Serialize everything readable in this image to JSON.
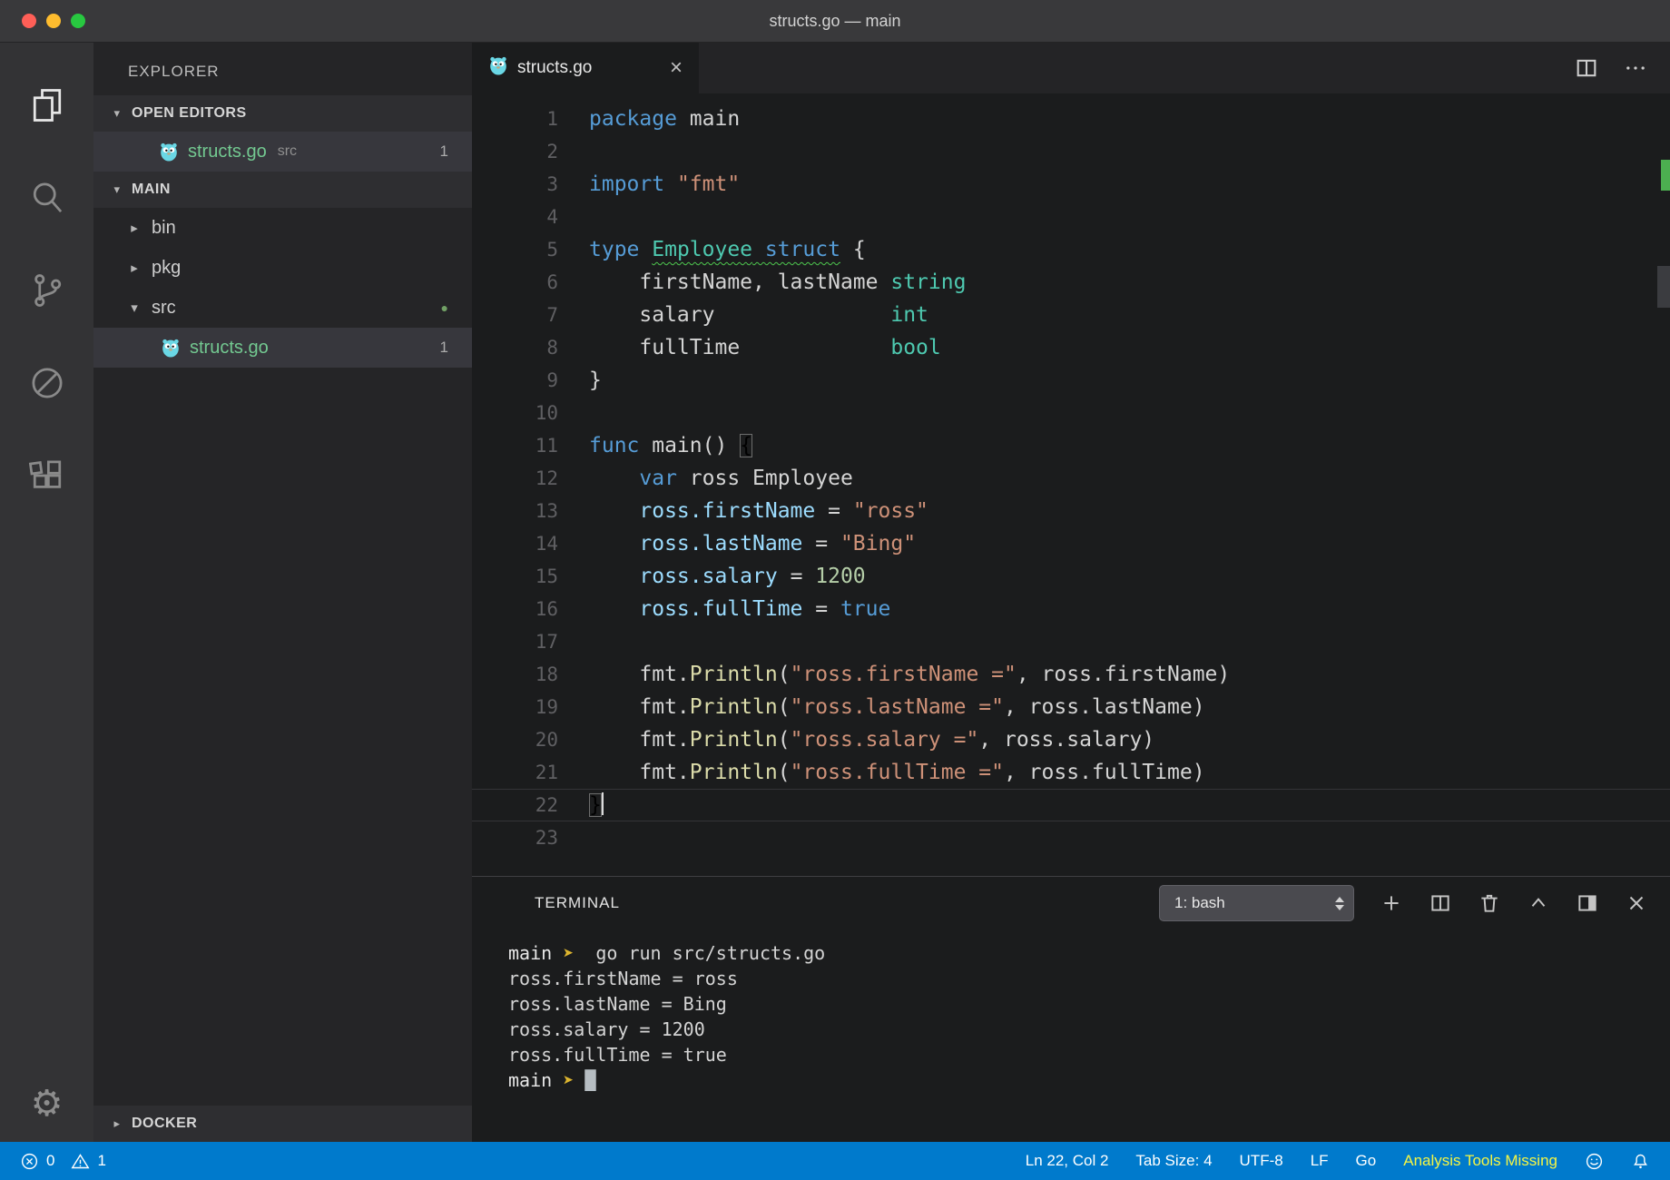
{
  "window": {
    "title": "structs.go — main"
  },
  "activity_bar": {
    "icons": [
      "files-icon",
      "search-icon",
      "source-control-icon",
      "debug-icon",
      "extensions-icon",
      "settings-gear-icon"
    ]
  },
  "sidebar": {
    "title": "EXPLORER",
    "open_editors": {
      "header": "OPEN EDITORS",
      "items": [
        {
          "file": "structs.go",
          "detail": "src",
          "badge": "1",
          "icon": "go-gopher-icon",
          "selected": true
        }
      ]
    },
    "folder_section": {
      "header": "MAIN",
      "tree": [
        {
          "type": "folder",
          "state": "collapsed",
          "label": "bin",
          "indent": 0
        },
        {
          "type": "folder",
          "state": "collapsed",
          "label": "pkg",
          "indent": 0
        },
        {
          "type": "folder",
          "state": "expanded",
          "label": "src",
          "indent": 0,
          "modified_dot": true
        },
        {
          "type": "file",
          "icon": "go-gopher-icon",
          "label": "structs.go",
          "indent": 1,
          "badge": "1",
          "selected": true,
          "green": true
        }
      ]
    },
    "bottom_section": {
      "header": "DOCKER",
      "state": "collapsed"
    }
  },
  "editor": {
    "tab": {
      "label": "structs.go",
      "close": "×"
    },
    "cursor_line": 22,
    "lines": [
      [
        [
          "k",
          "package"
        ],
        [
          "d",
          " main"
        ]
      ],
      [],
      [
        [
          "k",
          "import"
        ],
        [
          "d",
          " "
        ],
        [
          "s",
          "\"fmt\""
        ]
      ],
      [],
      [
        [
          "k",
          "type"
        ],
        [
          "d",
          " "
        ],
        [
          "ty sq",
          "Employee"
        ],
        [
          "d sq",
          " "
        ],
        [
          "k sq",
          "struct"
        ],
        [
          "d",
          " {"
        ]
      ],
      [
        [
          "d",
          "    firstName, lastName "
        ],
        [
          "ty",
          "string"
        ]
      ],
      [
        [
          "d",
          "    salary              "
        ],
        [
          "ty",
          "int"
        ]
      ],
      [
        [
          "d",
          "    fullTime            "
        ],
        [
          "ty",
          "bool"
        ]
      ],
      [
        [
          "d",
          "}"
        ]
      ],
      [],
      [
        [
          "k",
          "func"
        ],
        [
          "d",
          " main() "
        ],
        [
          "bm",
          "{"
        ]
      ],
      [
        [
          "d",
          "    "
        ],
        [
          "k",
          "var"
        ],
        [
          "d",
          " ross Employee"
        ]
      ],
      [
        [
          "d",
          "    "
        ],
        [
          "v",
          "ross.firstName"
        ],
        [
          "d",
          " = "
        ],
        [
          "s",
          "\"ross\""
        ]
      ],
      [
        [
          "d",
          "    "
        ],
        [
          "v",
          "ross.lastName"
        ],
        [
          "d",
          " = "
        ],
        [
          "s",
          "\"Bing\""
        ]
      ],
      [
        [
          "d",
          "    "
        ],
        [
          "v",
          "ross.salary"
        ],
        [
          "d",
          " = "
        ],
        [
          "n",
          "1200"
        ]
      ],
      [
        [
          "d",
          "    "
        ],
        [
          "v",
          "ross.fullTime"
        ],
        [
          "d",
          " = "
        ],
        [
          "k",
          "true"
        ]
      ],
      [],
      [
        [
          "d",
          "    fmt."
        ],
        [
          "fn",
          "Println"
        ],
        [
          "d",
          "("
        ],
        [
          "s",
          "\"ross.firstName =\""
        ],
        [
          "d",
          ", ross.firstName)"
        ]
      ],
      [
        [
          "d",
          "    fmt."
        ],
        [
          "fn",
          "Println"
        ],
        [
          "d",
          "("
        ],
        [
          "s",
          "\"ross.lastName =\""
        ],
        [
          "d",
          ", ross.lastName)"
        ]
      ],
      [
        [
          "d",
          "    fmt."
        ],
        [
          "fn",
          "Println"
        ],
        [
          "d",
          "("
        ],
        [
          "s",
          "\"ross.salary =\""
        ],
        [
          "d",
          ", ross.salary)"
        ]
      ],
      [
        [
          "d",
          "    fmt."
        ],
        [
          "fn",
          "Println"
        ],
        [
          "d",
          "("
        ],
        [
          "s",
          "\"ross.fullTime =\""
        ],
        [
          "d",
          ", ross.fullTime)"
        ]
      ],
      [
        [
          "bm",
          "}"
        ]
      ],
      []
    ]
  },
  "terminal": {
    "title": "TERMINAL",
    "shell_selector": "1: bash",
    "lines": [
      [
        [
          "p",
          "main"
        ],
        [
          "a",
          " ➤"
        ],
        [
          "d",
          "  go run src/structs.go"
        ]
      ],
      [
        [
          "d",
          "ross.firstName = ross"
        ]
      ],
      [
        [
          "d",
          "ross.lastName = Bing"
        ]
      ],
      [
        [
          "d",
          "ross.salary = 1200"
        ]
      ],
      [
        [
          "d",
          "ross.fullTime = true"
        ]
      ],
      [
        [
          "p",
          "main"
        ],
        [
          "a",
          " ➤"
        ],
        [
          "d",
          " "
        ],
        [
          "cb",
          "█"
        ]
      ]
    ]
  },
  "status_bar": {
    "errors": "0",
    "warnings": "1",
    "cursor_position": "Ln 22, Col 2",
    "tab_size": "Tab Size: 4",
    "encoding": "UTF-8",
    "eol": "LF",
    "language": "Go",
    "message": "Analysis Tools Missing"
  },
  "colors": {
    "accent": "#007acc",
    "keyword": "#569cd6",
    "string": "#ce9178",
    "type": "#4ec9b0",
    "number": "#b5cea8",
    "func": "#dcdcaa",
    "variable": "#9cdcfe",
    "file_green": "#73c991",
    "warning_text": "#f5f543",
    "squiggle": "#4ec94f",
    "prompt_arrow": "#ddb52f"
  }
}
